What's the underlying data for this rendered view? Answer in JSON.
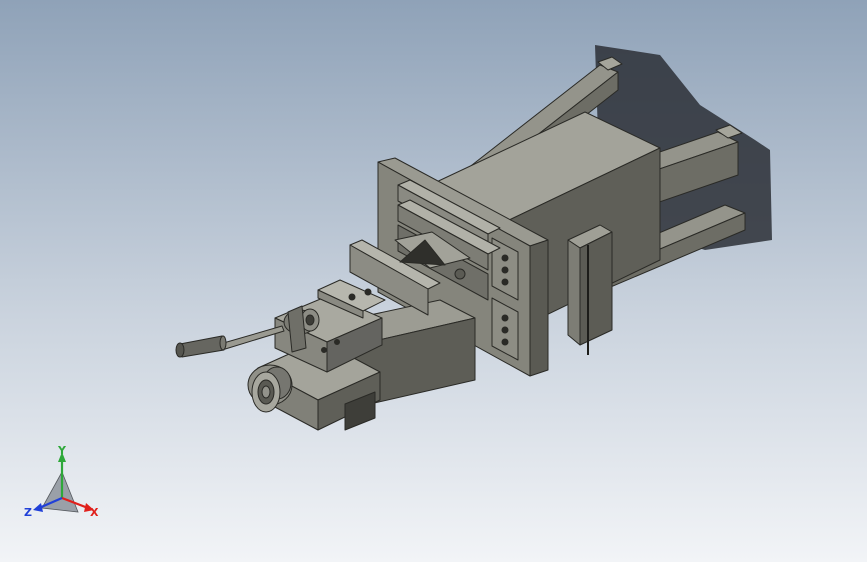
{
  "viewport": {
    "background_top": "#8fa2b8",
    "background_bottom": "#f2f4f7",
    "model_color": "#7b7b72"
  },
  "triad": {
    "x_label": "X",
    "y_label": "Y",
    "z_label": "Z",
    "x_color": "#e0201c",
    "y_color": "#2ea83a",
    "z_color": "#2040d8"
  }
}
